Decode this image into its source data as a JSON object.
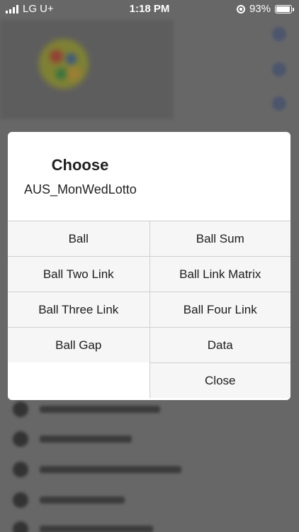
{
  "status_bar": {
    "carrier": "LG U+",
    "time": "1:18 PM",
    "battery": "93%",
    "battery_level": 0.93
  },
  "dialog": {
    "title": "Choose",
    "subtitle": "AUS_MonWedLotto",
    "options": [
      [
        "Ball",
        "Ball Sum"
      ],
      [
        "Ball Two Link",
        "Ball Link Matrix"
      ],
      [
        "Ball Three Link",
        "Ball Four Link"
      ],
      [
        "Ball Gap",
        "Data"
      ],
      [
        "",
        "Close"
      ]
    ]
  },
  "colors": {
    "dialog_bg": "#ffffff",
    "option_bg": "#f6f6f6",
    "divider": "#cfcfcf"
  }
}
